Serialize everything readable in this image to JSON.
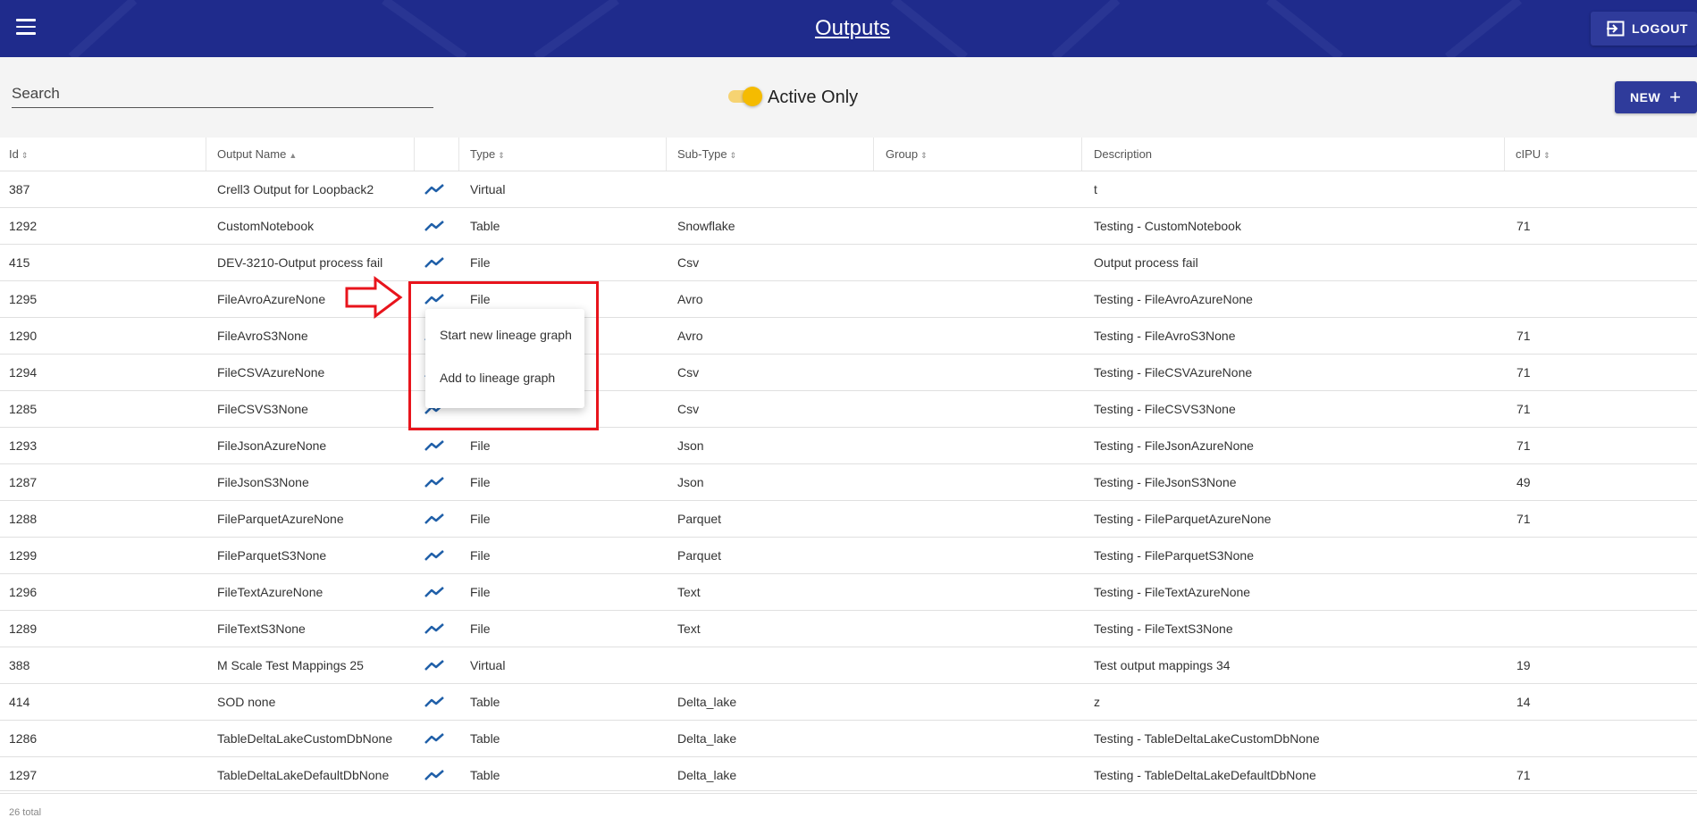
{
  "header": {
    "title": "Outputs",
    "logout_label": "LOGOUT"
  },
  "toolbar": {
    "search_placeholder": "Search",
    "toggle_label": "Active Only",
    "toggle_on": true,
    "new_label": "NEW"
  },
  "columns": [
    "Id",
    "Output Name",
    "",
    "Type",
    "Sub-Type",
    "Group",
    "Description",
    "cIPU"
  ],
  "rows": [
    {
      "id": "387",
      "name": "Crell3 Output for Loopback2",
      "type": "Virtual",
      "subtype": "",
      "group": "",
      "desc": "t",
      "cipu": ""
    },
    {
      "id": "1292",
      "name": "CustomNotebook",
      "type": "Table",
      "subtype": "Snowflake",
      "group": "",
      "desc": "Testing - CustomNotebook",
      "cipu": "71"
    },
    {
      "id": "415",
      "name": "DEV-3210-Output process fail",
      "type": "File",
      "subtype": "Csv",
      "group": "",
      "desc": "Output process fail",
      "cipu": ""
    },
    {
      "id": "1295",
      "name": "FileAvroAzureNone",
      "type": "File",
      "subtype": "Avro",
      "group": "",
      "desc": "Testing - FileAvroAzureNone",
      "cipu": ""
    },
    {
      "id": "1290",
      "name": "FileAvroS3None",
      "type": "",
      "subtype": "Avro",
      "group": "",
      "desc": "Testing - FileAvroS3None",
      "cipu": "71"
    },
    {
      "id": "1294",
      "name": "FileCSVAzureNone",
      "type": "",
      "subtype": "Csv",
      "group": "",
      "desc": "Testing - FileCSVAzureNone",
      "cipu": "71"
    },
    {
      "id": "1285",
      "name": "FileCSVS3None",
      "type": "",
      "subtype": "Csv",
      "group": "",
      "desc": "Testing - FileCSVS3None",
      "cipu": "71"
    },
    {
      "id": "1293",
      "name": "FileJsonAzureNone",
      "type": "File",
      "subtype": "Json",
      "group": "",
      "desc": "Testing - FileJsonAzureNone",
      "cipu": "71"
    },
    {
      "id": "1287",
      "name": "FileJsonS3None",
      "type": "File",
      "subtype": "Json",
      "group": "",
      "desc": "Testing - FileJsonS3None",
      "cipu": "49"
    },
    {
      "id": "1288",
      "name": "FileParquetAzureNone",
      "type": "File",
      "subtype": "Parquet",
      "group": "",
      "desc": "Testing - FileParquetAzureNone",
      "cipu": "71"
    },
    {
      "id": "1299",
      "name": "FileParquetS3None",
      "type": "File",
      "subtype": "Parquet",
      "group": "",
      "desc": "Testing - FileParquetS3None",
      "cipu": ""
    },
    {
      "id": "1296",
      "name": "FileTextAzureNone",
      "type": "File",
      "subtype": "Text",
      "group": "",
      "desc": "Testing - FileTextAzureNone",
      "cipu": ""
    },
    {
      "id": "1289",
      "name": "FileTextS3None",
      "type": "File",
      "subtype": "Text",
      "group": "",
      "desc": "Testing - FileTextS3None",
      "cipu": ""
    },
    {
      "id": "388",
      "name": "M Scale Test Mappings 25",
      "type": "Virtual",
      "subtype": "",
      "group": "",
      "desc": "Test output mappings 34",
      "cipu": "19"
    },
    {
      "id": "414",
      "name": "SOD none",
      "type": "Table",
      "subtype": "Delta_lake",
      "group": "",
      "desc": "z",
      "cipu": "14"
    },
    {
      "id": "1286",
      "name": "TableDeltaLakeCustomDbNone",
      "type": "Table",
      "subtype": "Delta_lake",
      "group": "",
      "desc": "Testing - TableDeltaLakeCustomDbNone",
      "cipu": ""
    },
    {
      "id": "1297",
      "name": "TableDeltaLakeDefaultDbNone",
      "type": "Table",
      "subtype": "Delta_lake",
      "group": "",
      "desc": "Testing - TableDeltaLakeDefaultDbNone",
      "cipu": "71"
    }
  ],
  "context_menu": {
    "item_start": "Start new lineage graph",
    "item_add": "Add to lineage graph"
  },
  "footer": {
    "total": "26 total"
  },
  "colors": {
    "header_bg": "#1f2b8c",
    "button_bg": "#2f3b9b",
    "toggle": "#f5bb00",
    "annotation": "#e8141c",
    "trend_icon": "#1f5fa8"
  },
  "icons": {
    "menu": "hamburger-icon",
    "logout": "logout-icon",
    "new": "plus-icon",
    "row": "trend-line-icon",
    "annotation": "red-arrow-icon"
  }
}
